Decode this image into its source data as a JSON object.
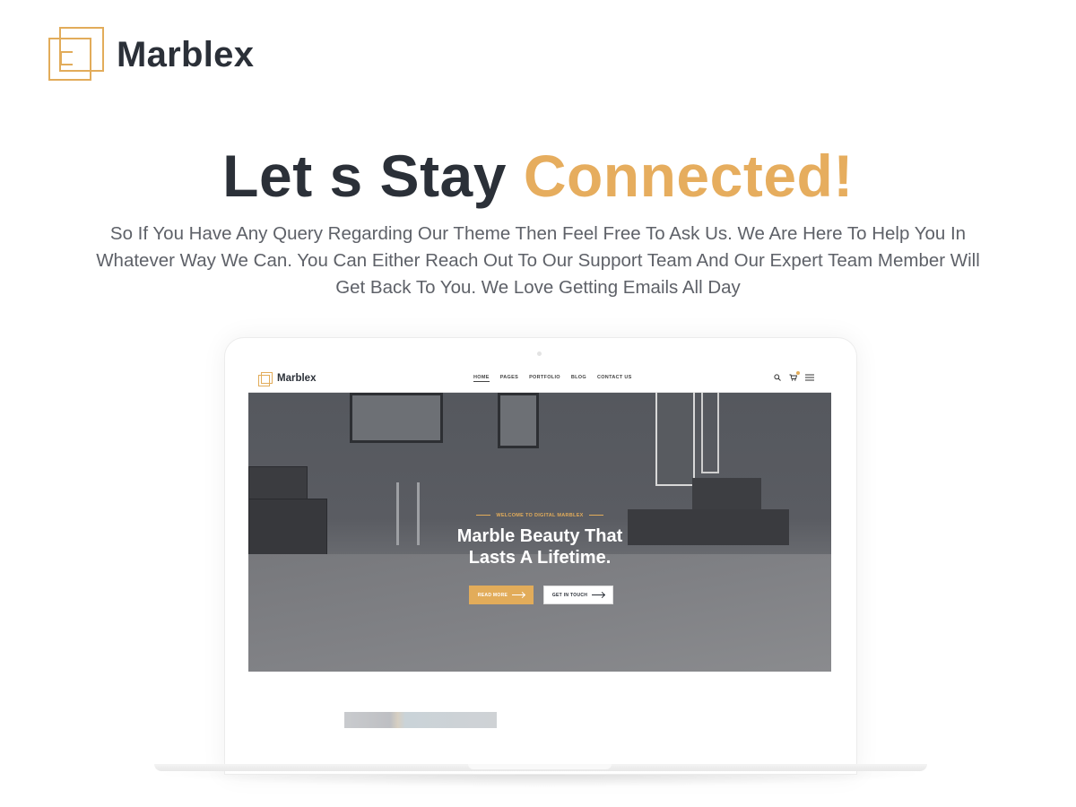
{
  "brand": {
    "name": "Marblex",
    "accent_color": "#e2ac5a",
    "icon": "logo-squares-icon"
  },
  "headline": {
    "part1": "Let s Stay ",
    "part2": "Connected!"
  },
  "subtext": "So If You Have Any Query Regarding Our Theme Then Feel Free To Ask Us. We Are Here To Help You In Whatever Way We Can. You Can Either Reach Out To Our Support Team And Our Expert Team Member Will Get Back To You. We Love Getting Emails All Day",
  "screen": {
    "logo": "Marblex",
    "menu": [
      "HOME",
      "PAGES",
      "PORTFOLIO",
      "BLOG",
      "CONTACT US"
    ],
    "active_menu": "HOME",
    "icons": [
      "search-icon",
      "cart-icon",
      "hamburger-menu-icon"
    ],
    "hero": {
      "kicker": "WELCOME TO DIGITAL MARBLEX",
      "title_line1": "Marble Beauty That",
      "title_line2": "Lasts A Lifetime.",
      "primary_button": "READ MORE",
      "secondary_button": "GET IN TOUCH"
    }
  }
}
